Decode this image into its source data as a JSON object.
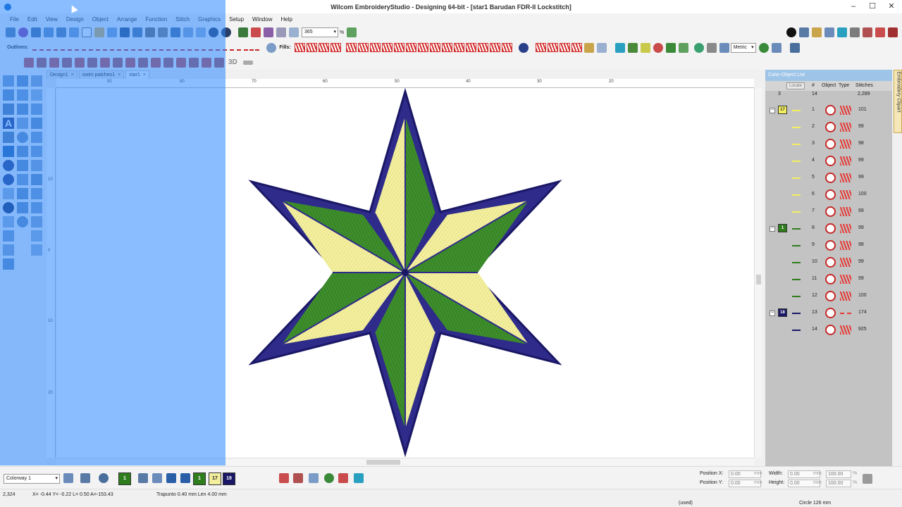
{
  "window": {
    "title": "Wilcom EmbroideryStudio - Designing 64-bit - [star1     Barudan FDR-II Lockstitch]",
    "minimize": "–",
    "maximize": "☐",
    "close": "✕"
  },
  "menu": [
    "File",
    "Edit",
    "View",
    "Design",
    "Object",
    "Arrange",
    "Function",
    "Stitch",
    "Graphics",
    "Setup",
    "Window",
    "Help"
  ],
  "toolbar": {
    "zoom_value": "365",
    "zoom_unit": "%",
    "outlines_label": "Outlines:",
    "fills_label": "Fills:",
    "units_value": "Metric",
    "btn_3d": "3D"
  },
  "tabs": [
    {
      "label": "Design1"
    },
    {
      "label": "swim patches1"
    },
    {
      "label": "star1"
    }
  ],
  "ruler": {
    "h_labels": [
      "90",
      "80",
      "70",
      "60",
      "50",
      "40",
      "30",
      "20"
    ],
    "v_labels": [
      "10",
      "0",
      "10",
      "20"
    ]
  },
  "colors": {
    "navy": "#2e2b8a",
    "green": "#3e8e2c",
    "yellow": "#f3ef9e",
    "accent_blue": "#9ec4e8"
  },
  "panel": {
    "title": "Color-Object List",
    "locate_label": "Locate",
    "headers": {
      "num": "#",
      "object": "Object",
      "type": "Type",
      "stitches": "Stitches"
    },
    "summary": {
      "colors": "3",
      "objects": "14",
      "stitches": "2,289"
    },
    "side_tab": "Embroidery Clipart",
    "rows": [
      {
        "group": "17",
        "num": "1",
        "stitches": "101",
        "color": "#f3ef5e",
        "type": "fill"
      },
      {
        "group": "",
        "num": "2",
        "stitches": "99",
        "color": "#f3ef5e",
        "type": "fill"
      },
      {
        "group": "",
        "num": "3",
        "stitches": "98",
        "color": "#f3ef5e",
        "type": "fill"
      },
      {
        "group": "",
        "num": "4",
        "stitches": "99",
        "color": "#f3ef5e",
        "type": "fill"
      },
      {
        "group": "",
        "num": "5",
        "stitches": "99",
        "color": "#f3ef5e",
        "type": "fill"
      },
      {
        "group": "",
        "num": "6",
        "stitches": "100",
        "color": "#f3ef5e",
        "type": "fill"
      },
      {
        "group": "",
        "num": "7",
        "stitches": "99",
        "color": "#f3ef5e",
        "type": "fill"
      },
      {
        "group": "1",
        "num": "8",
        "stitches": "99",
        "color": "#2f7d1d",
        "type": "fill"
      },
      {
        "group": "",
        "num": "9",
        "stitches": "98",
        "color": "#2f7d1d",
        "type": "fill"
      },
      {
        "group": "",
        "num": "10",
        "stitches": "99",
        "color": "#2f7d1d",
        "type": "fill"
      },
      {
        "group": "",
        "num": "11",
        "stitches": "99",
        "color": "#2f7d1d",
        "type": "fill"
      },
      {
        "group": "",
        "num": "12",
        "stitches": "100",
        "color": "#2f7d1d",
        "type": "fill"
      },
      {
        "group": "18",
        "num": "13",
        "stitches": "174",
        "color": "#1a1766",
        "type": "run"
      },
      {
        "group": "",
        "num": "14",
        "stitches": "925",
        "color": "#1a1766",
        "type": "fill"
      }
    ]
  },
  "bottom": {
    "colorway": "Colorway 1",
    "chips": [
      {
        "label": "1",
        "color": "#2f7d1d"
      },
      {
        "label": "17",
        "color": "#f3ef9e"
      },
      {
        "label": "18",
        "color": "#1a1766"
      }
    ],
    "position_x_label": "Position X:",
    "position_y_label": "Position Y:",
    "width_label": "Width:",
    "height_label": "Height:",
    "pos_x": "0.00",
    "pos_y": "0.00",
    "width": "0.00",
    "height": "0.00",
    "unit": "mm",
    "pct_w": "100.00",
    "pct_h": "100.00",
    "pct": "%"
  },
  "status": {
    "count": "2,324",
    "coords": "X= -0.44 Y= -0.22 L= 0.50 A=-153.43",
    "stitch_info": "Trapunto  0.40 mm Len  4.00 mm",
    "used": "(used)",
    "shape": "Circle 126 mm"
  }
}
